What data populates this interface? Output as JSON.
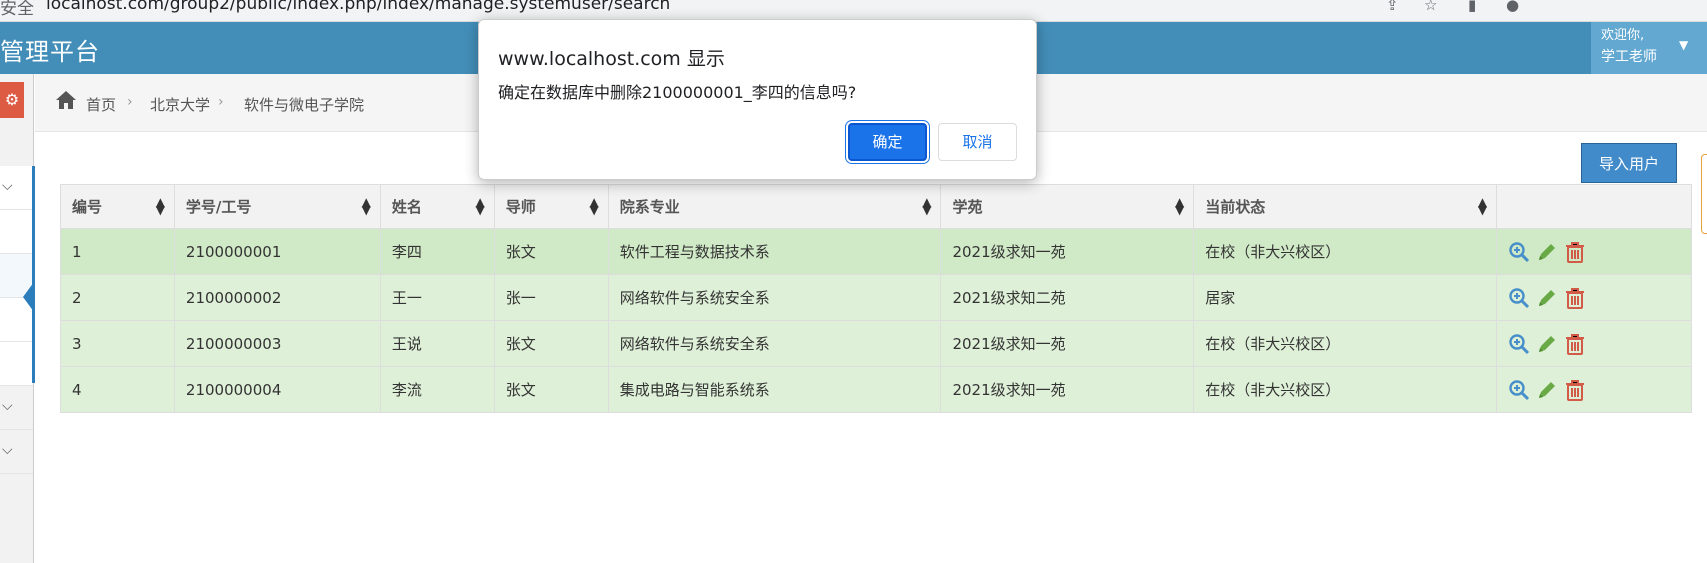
{
  "browser": {
    "security_label": "安全",
    "url": "localhost.com/group2/public/index.php/index/manage.systemuser/search"
  },
  "navbar": {
    "brand": "管理平台",
    "user_greeting": "欢迎你,",
    "user_name": "学工老师"
  },
  "breadcrumbs": [
    "首页",
    "北京大学",
    "软件与微电子学院"
  ],
  "toolbar": {
    "import_label": "导入用户"
  },
  "table": {
    "headers": [
      "编号",
      "学号/工号",
      "姓名",
      "导师",
      "院系专业",
      "学苑",
      "当前状态"
    ],
    "rows": [
      [
        "1",
        "2100000001",
        "李四",
        "张文",
        "软件工程与数据技术系",
        "2021级求知一苑",
        "在校（非大兴校区）"
      ],
      [
        "2",
        "2100000002",
        "王一",
        "张一",
        "网络软件与系统安全系",
        "2021级求知二苑",
        "居家"
      ],
      [
        "3",
        "2100000003",
        "王说",
        "张文",
        "网络软件与系统安全系",
        "2021级求知一苑",
        "在校（非大兴校区）"
      ],
      [
        "4",
        "2100000004",
        "李流",
        "张文",
        "集成电路与智能系统系",
        "2021级求知一苑",
        "在校（非大兴校区）"
      ]
    ]
  },
  "dialog": {
    "title": "www.localhost.com 显示",
    "message": "确定在数据库中删除2100000001_李四的信息吗?",
    "ok_label": "确定",
    "cancel_label": "取消"
  },
  "colors": {
    "navbar": "#438eb9",
    "row_highlight": "#dff0d8",
    "primary_button": "#1a73e8",
    "delete_icon": "#d15b47",
    "edit_icon": "#69aa46",
    "view_icon": "#478fca"
  },
  "icons": {
    "row_actions": [
      "zoom-in-icon",
      "pencil-icon",
      "trash-icon"
    ],
    "home": "home-icon"
  }
}
